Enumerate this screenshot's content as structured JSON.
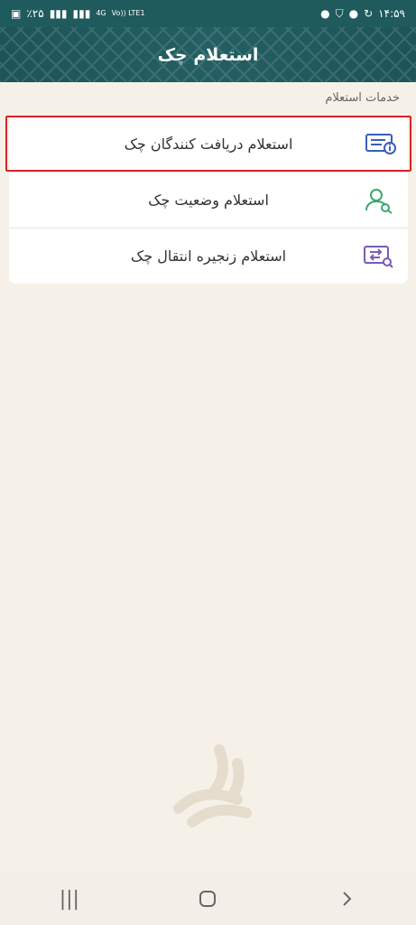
{
  "status_bar": {
    "time": "۱۴:۵۹",
    "battery": "٪۲۵",
    "network": "4G",
    "volte": "Vo)) LTE1"
  },
  "header": {
    "title": "استعلام چک"
  },
  "section": {
    "label": "خدمات استعلام"
  },
  "items": [
    {
      "label": "استعلام دریافت کنندگان چک",
      "icon": "check-info-icon"
    },
    {
      "label": "استعلام وضعیت چک",
      "icon": "user-search-icon"
    },
    {
      "label": "استعلام زنجیره انتقال چک",
      "icon": "transfer-search-icon"
    }
  ],
  "colors": {
    "header_bg": "#1f5a5c",
    "background": "#f6f1e8",
    "highlight": "#d8232a",
    "icon_blue": "#3b5db8",
    "icon_green": "#3aa86b",
    "icon_purple": "#7a5bb5"
  },
  "nav": {
    "recents": "|||",
    "home": "home-icon",
    "back": "back-icon"
  }
}
